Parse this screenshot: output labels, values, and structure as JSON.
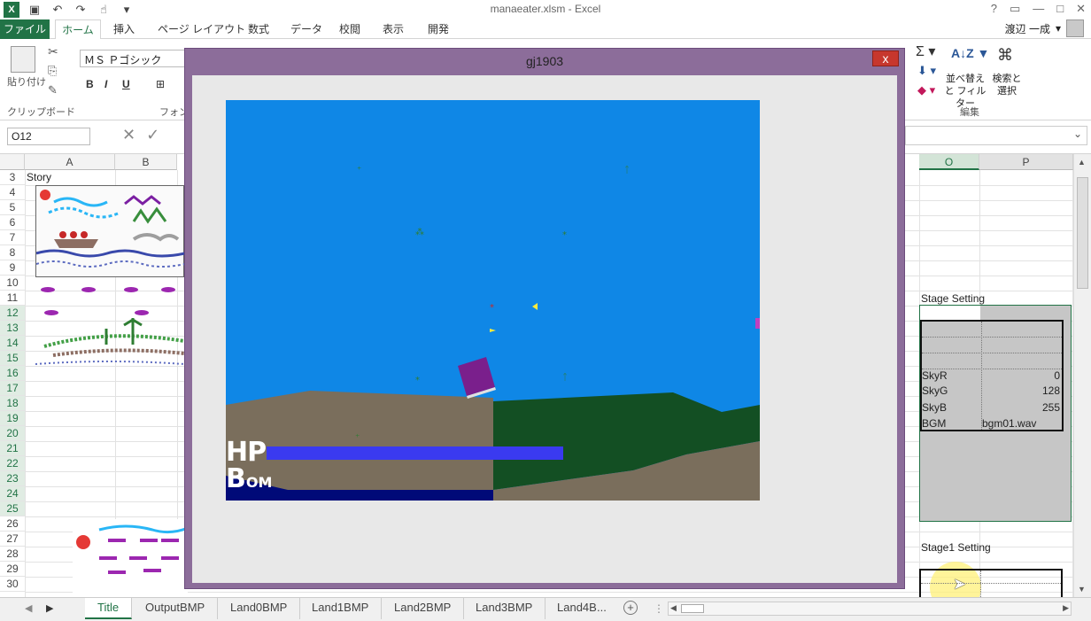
{
  "app": {
    "doc_title": "manaeater.xlsm - Excel",
    "user_name": "渡辺 一成",
    "help_glyph": "?"
  },
  "ribbon_tabs": [
    "ファイル",
    "ホーム",
    "挿入",
    "ページ レイアウト",
    "数式",
    "データ",
    "校閲",
    "表示",
    "開発"
  ],
  "ribbon": {
    "paste_label": "貼り付け",
    "clipboard_group": "クリップボード",
    "font_name": "ＭＳ Ｐゴシック",
    "font_group": "フォント",
    "bold": "B",
    "italic": "I",
    "underline": "U",
    "sort_filter": "並べ替えと フィルター",
    "find_select": "検索と 選択",
    "edit_group": "編集"
  },
  "formula_bar": {
    "name_box": "O12",
    "cancel_glyph": "✕",
    "enter_glyph": "✓"
  },
  "sheet": {
    "left_columns": [
      "A",
      "B"
    ],
    "right_columns": [
      "O",
      "P"
    ],
    "rows": [
      "3",
      "4",
      "5",
      "6",
      "7",
      "8",
      "9",
      "10",
      "11",
      "12",
      "13",
      "14",
      "15",
      "16",
      "17",
      "18",
      "19",
      "20",
      "21",
      "22",
      "23",
      "24",
      "25",
      "26",
      "27",
      "28",
      "29",
      "30"
    ],
    "story_cell": "Story",
    "stage_setting_label": "Stage Setting",
    "stage_settings": [
      {
        "key": "SkyR",
        "value": "0"
      },
      {
        "key": "SkyG",
        "value": "128"
      },
      {
        "key": "SkyB",
        "value": "255"
      },
      {
        "key": "BGM",
        "value": "bgm01.wav"
      }
    ],
    "stage1_setting_label": "Stage1  Setting"
  },
  "sheet_tabs": [
    "Title",
    "OutputBMP",
    "Land0BMP",
    "Land1BMP",
    "Land2BMP",
    "Land3BMP",
    "Land4B"
  ],
  "active_sheet": "Title",
  "sheet_tabs_more": "...",
  "game_window": {
    "title": "gj1903",
    "close_glyph": "x",
    "hp_label": "HP",
    "bom_label_big": "B",
    "bom_label_small": "OM",
    "hp_fraction": 0.58,
    "colors": {
      "sky": "#0f87e6",
      "ground_dark": "#000a78",
      "ground_brown": "#7a6e5c",
      "ground_green": "#134f23",
      "hp_bar": "#3a3af0",
      "book": "#7a1f8c"
    }
  },
  "colors": {
    "excel_green": "#217346",
    "selection_gray": "#c6c6c6",
    "window_frame": "#8c6d9a"
  }
}
